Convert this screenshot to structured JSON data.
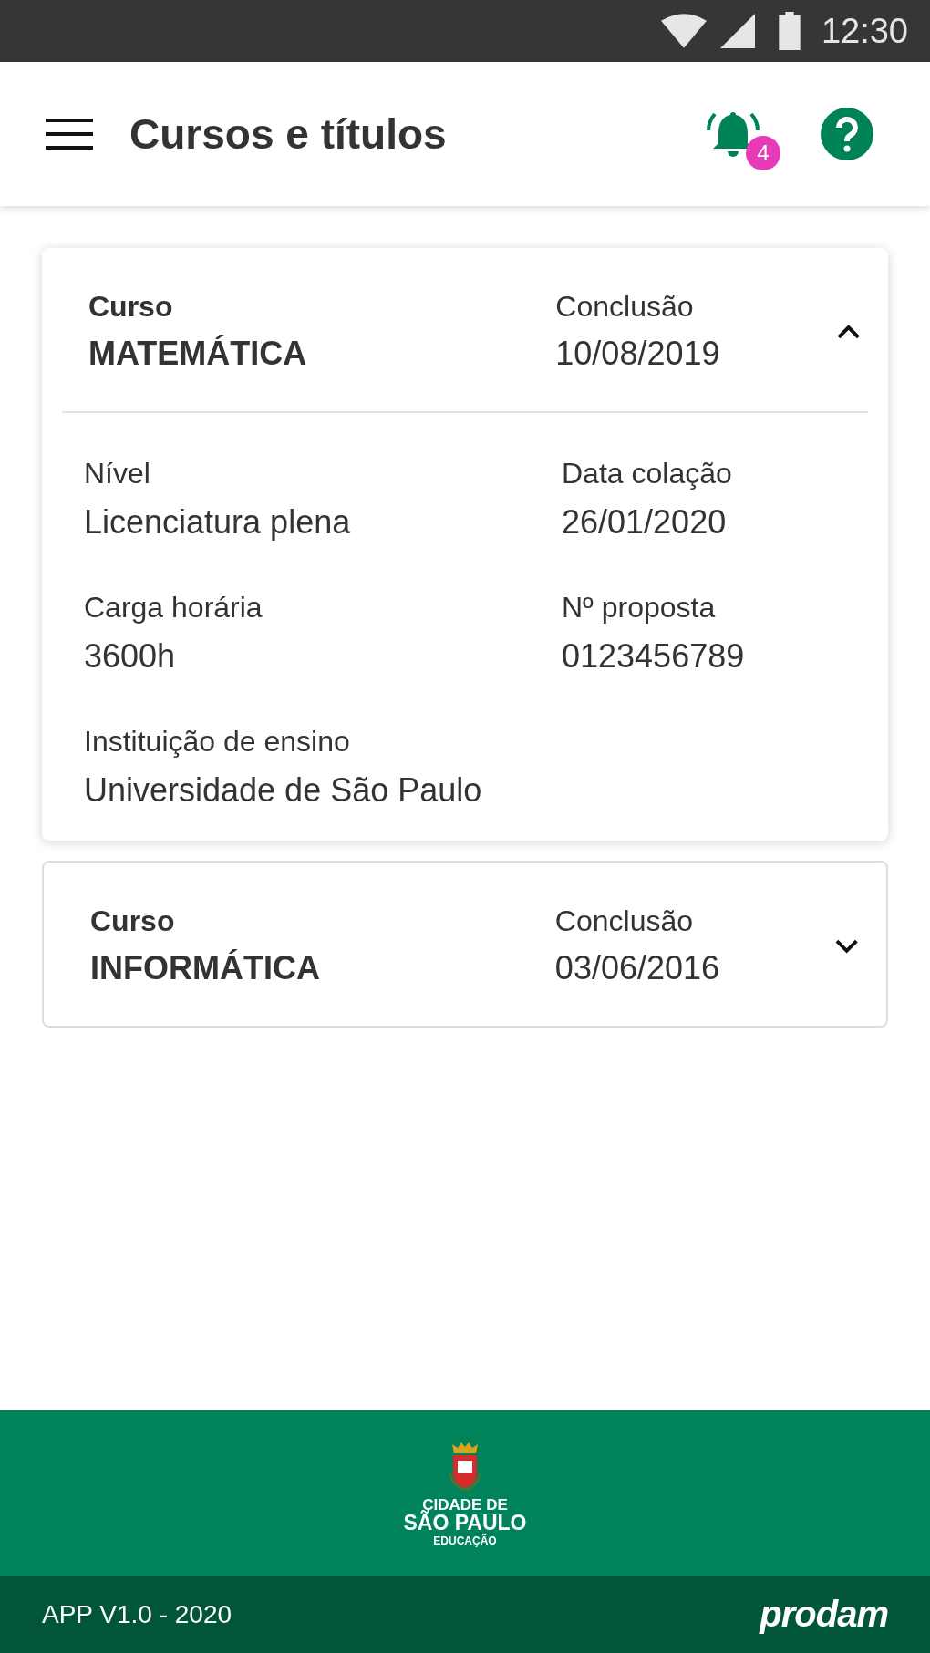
{
  "status_bar": {
    "time": "12:30"
  },
  "app_bar": {
    "title": "Cursos e títulos",
    "notification_count": "4"
  },
  "courses": [
    {
      "course_label": "Curso",
      "course_name": "MATEMÁTICA",
      "conclusion_label": "Conclusão",
      "conclusion_date": "10/08/2019",
      "expanded": true,
      "details": [
        {
          "label": "Nível",
          "value": "Licenciatura plena"
        },
        {
          "label": "Data colação",
          "value": "26/01/2020"
        },
        {
          "label": "Carga horária",
          "value": "3600h"
        },
        {
          "label": "Nº proposta",
          "value": "0123456789"
        },
        {
          "label": "Instituição de ensino",
          "value": "Universidade de São Paulo"
        }
      ]
    },
    {
      "course_label": "Curso",
      "course_name": "INFORMÁTICA",
      "conclusion_label": "Conclusão",
      "conclusion_date": "03/06/2016",
      "expanded": false
    }
  ],
  "footer": {
    "logo_lines": [
      "CIDADE DE",
      "SÃO PAULO",
      "EDUCAÇÃO"
    ],
    "version": "APP V1.0 - 2020",
    "brand": "prodam"
  }
}
